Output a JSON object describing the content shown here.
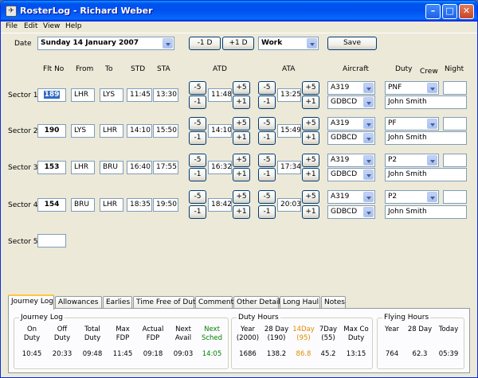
{
  "window": {
    "title": "RosterLog - Richard Weber",
    "app_icon": "roster-icon"
  },
  "menu": [
    "File",
    "Edit",
    "View",
    "Help"
  ],
  "toolbar": {
    "date_label": "Date",
    "date_value": "Sunday   14  January  2007",
    "minus1d": "-1 D",
    "plus1d": "+1 D",
    "day_type": "Work",
    "save": "Save"
  },
  "columns": {
    "flt_no": "Flt No",
    "from": "From",
    "to": "To",
    "std": "STD",
    "sta": "STA",
    "atd": "ATD",
    "ata": "ATA",
    "aircraft": "Aircraft",
    "duty": "Duty",
    "crew": "Crew",
    "night": "Night"
  },
  "adj": {
    "minus5": "-5",
    "minus1": "-1",
    "plus5": "+5",
    "plus1": "+1"
  },
  "sectors": [
    {
      "label": "Sector 1",
      "flt_no": "189",
      "from": "LHR",
      "to": "LYS",
      "std": "11:45",
      "sta": "13:30",
      "atd": "11:48",
      "ata": "13:25",
      "aircraft_type": "A319",
      "aircraft_reg": "GDBCD",
      "duty": "PNF",
      "crew": "John Smith",
      "night": ""
    },
    {
      "label": "Sector 2",
      "flt_no": "190",
      "from": "LYS",
      "to": "LHR",
      "std": "14:10",
      "sta": "15:50",
      "atd": "14:10",
      "ata": "15:49",
      "aircraft_type": "A319",
      "aircraft_reg": "GDBCD",
      "duty": "PF",
      "crew": "John Smith",
      "night": ""
    },
    {
      "label": "Sector 3",
      "flt_no": "153",
      "from": "LHR",
      "to": "BRU",
      "std": "16:40",
      "sta": "17:55",
      "atd": "16:32",
      "ata": "17:34",
      "aircraft_type": "A319",
      "aircraft_reg": "GDBCD",
      "duty": "P2",
      "crew": "John Smith",
      "night": ""
    },
    {
      "label": "Sector 4",
      "flt_no": "154",
      "from": "BRU",
      "to": "LHR",
      "std": "18:35",
      "sta": "19:50",
      "atd": "18:42",
      "ata": "20:03",
      "aircraft_type": "A319",
      "aircraft_reg": "GDBCD",
      "duty": "P2",
      "crew": "John Smith",
      "night": ""
    },
    {
      "label": "Sector 5",
      "flt_no": ""
    }
  ],
  "tabs": [
    "Journey Log",
    "Allowances",
    "Earlies",
    "Time Free of Duty",
    "Comments",
    "Other Details",
    "Long Haul",
    "Notes"
  ],
  "journey_log": {
    "title": "Journey Log",
    "headers": [
      [
        "On",
        "Duty"
      ],
      [
        "Off",
        "Duty"
      ],
      [
        "Total",
        "Duty"
      ],
      [
        "Max",
        "FDP"
      ],
      [
        "Actual",
        "FDP"
      ],
      [
        "Next",
        "Avail"
      ],
      [
        "Next",
        "Sched"
      ]
    ],
    "values": [
      "10:45",
      "20:33",
      "09:48",
      "11:45",
      "09:18",
      "09:03",
      "14:05"
    ]
  },
  "duty_hours": {
    "title": "Duty Hours",
    "headers": [
      [
        "Year",
        "(2000)"
      ],
      [
        "28 Day",
        "(190)"
      ],
      [
        "14Day",
        "(95)"
      ],
      [
        "7Day",
        "(55)"
      ],
      [
        "Max Co",
        "Duty"
      ]
    ],
    "values": [
      "1686",
      "138.2",
      "86.8",
      "45.2",
      "13:15"
    ]
  },
  "flying_hours": {
    "title": "Flying Hours",
    "headers": [
      "Year",
      "28 Day",
      "Today"
    ],
    "values": [
      "764",
      "62.3",
      "05:39"
    ]
  },
  "colors": {
    "next_sched": "#008000",
    "day14": "#e08a00"
  }
}
